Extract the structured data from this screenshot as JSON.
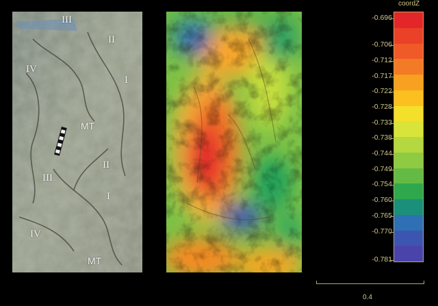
{
  "photo": {
    "labels": [
      "III",
      "II",
      "IV",
      "I",
      "MT",
      "II",
      "III",
      "I",
      "IV",
      "MT"
    ]
  },
  "legend": {
    "title": "coordZ",
    "ticks": [
      "-0.696",
      "-0.706",
      "-0.712",
      "-0.717",
      "-0.722",
      "-0.728",
      "-0.733",
      "-0.738",
      "-0.744",
      "-0.749",
      "-0.754",
      "-0.760",
      "-0.765",
      "-0.770",
      "-0.781"
    ],
    "colors": [
      "#e3262a",
      "#ea4129",
      "#f05a28",
      "#f47b25",
      "#f8a020",
      "#fbbf1f",
      "#f4df2a",
      "#d9e43a",
      "#b5d740",
      "#8fca43",
      "#63bb45",
      "#2fa84d",
      "#1a8f7a",
      "#2f6fb3",
      "#3c55b0",
      "#4a44aa"
    ]
  },
  "scale": {
    "label": "0.4"
  }
}
